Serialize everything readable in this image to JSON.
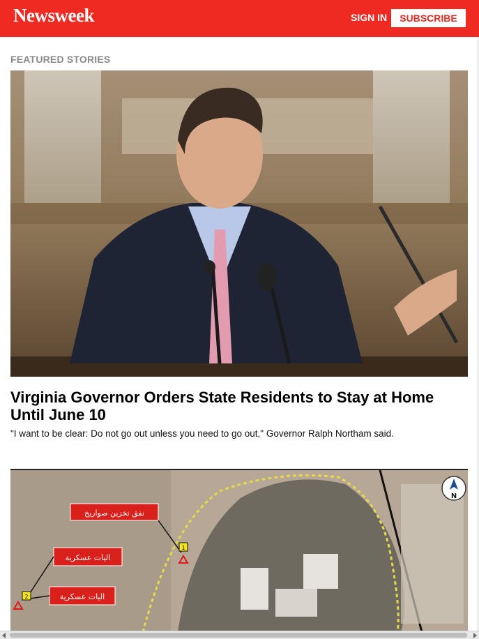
{
  "header": {
    "logo": "Newsweek",
    "sign_in": "SIGN IN",
    "subscribe": "SUBSCRIBE",
    "brand_color": "#ee2a22"
  },
  "featured": {
    "section_label": "FEATURED STORIES",
    "story1": {
      "headline": "Virginia Governor Orders State Residents to Stay at Home Until June 10",
      "summary": "\"I want to be clear: Do not go out unless you need to go out,\" Governor Ralph Northam said."
    },
    "story2": {
      "map_labels": [
        "نفق تخزين صواريخ",
        "اليات عسكرية",
        "اليات عسكرية"
      ],
      "markers": [
        "1",
        "2"
      ],
      "compass": "N"
    }
  }
}
